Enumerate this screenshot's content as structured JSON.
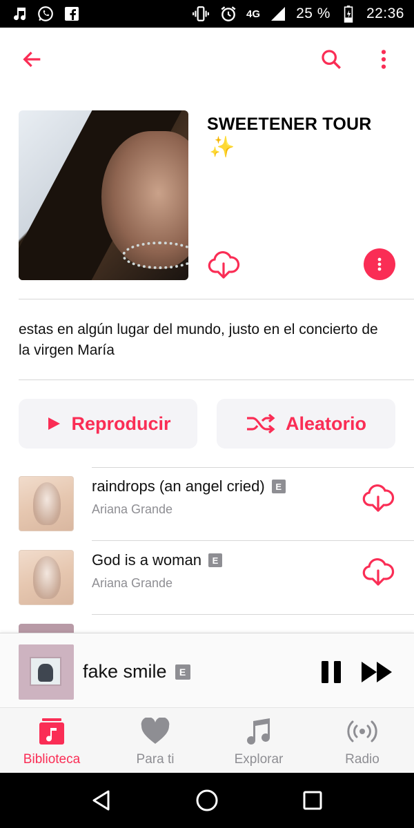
{
  "status_bar": {
    "network": "4G",
    "battery": "25 %",
    "time": "22:36"
  },
  "app_bar": {
    "back_icon": "arrow-left-icon",
    "search_icon": "search-icon",
    "more_icon": "more-vertical-icon"
  },
  "playlist": {
    "title": "SWEETENER TOUR",
    "title_emoji": "✨",
    "description": "estas en algún lugar del mundo, justo en el concierto de la virgen María"
  },
  "actions": {
    "play_label": "Reproducir",
    "shuffle_label": "Aleatorio"
  },
  "tracks": [
    {
      "title": "raindrops (an angel cried)",
      "explicit": "E",
      "artist": "Ariana Grande"
    },
    {
      "title": "God is a woman",
      "explicit": "E",
      "artist": "Ariana Grande"
    }
  ],
  "now_playing": {
    "title": "fake smile",
    "explicit": "E"
  },
  "tabs": [
    {
      "label": "Biblioteca",
      "icon": "library-icon",
      "active": true
    },
    {
      "label": "Para ti",
      "icon": "heart-icon",
      "active": false
    },
    {
      "label": "Explorar",
      "icon": "music-note-icon",
      "active": false
    },
    {
      "label": "Radio",
      "icon": "radio-icon",
      "active": false
    }
  ],
  "colors": {
    "accent": "#fa2d55",
    "secondary_text": "#8e8e93",
    "button_bg": "#f4f4f7"
  }
}
